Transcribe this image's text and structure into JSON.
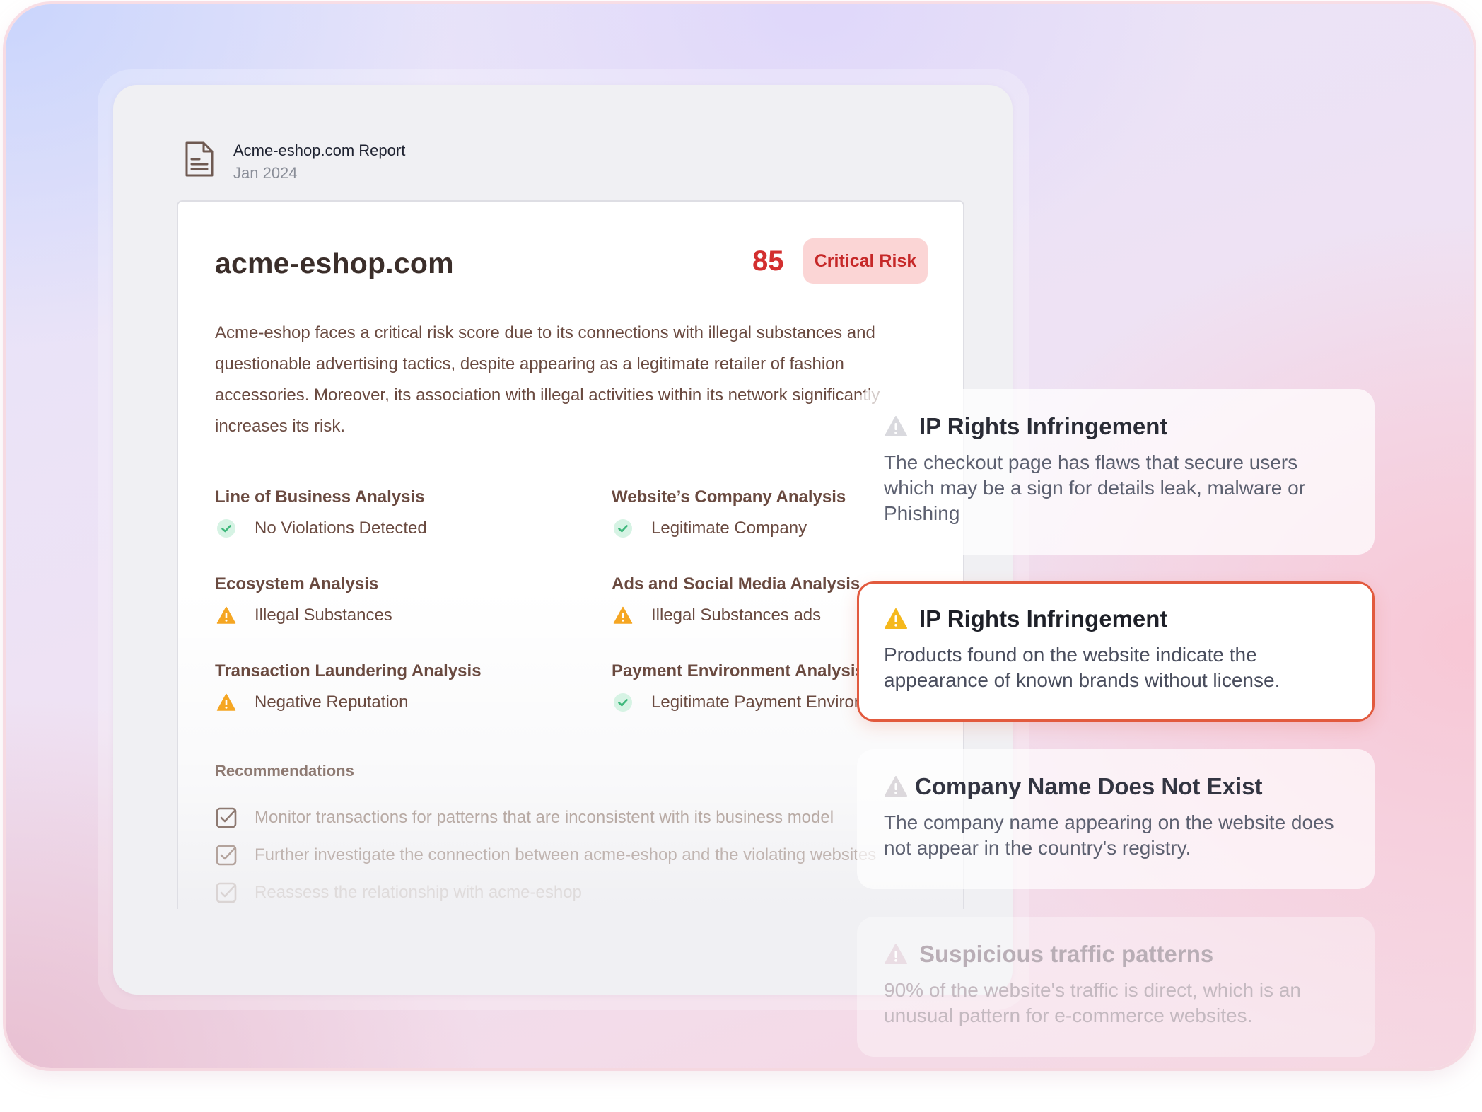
{
  "report": {
    "title": "Acme-eshop.com Report",
    "date": "Jan 2024"
  },
  "card": {
    "domain": "acme-eshop.com",
    "score": "85",
    "risk_label": "Critical Risk",
    "summary": "Acme-eshop faces a critical risk score due to its connections with illegal substances and questionable advertising tactics, despite appearing as a legitimate retailer of fashion accessories. Moreover, its association with illegal activities within its network significantly increases its risk.",
    "analyses": [
      {
        "title": "Line of Business Analysis",
        "result": "No Violations Detected",
        "status": "ok"
      },
      {
        "title": "Website’s Company Analysis",
        "result": "Legitimate Company",
        "status": "ok"
      },
      {
        "title": "Ecosystem Analysis",
        "result": "Illegal Substances",
        "status": "warning"
      },
      {
        "title": "Ads and Social Media Analysis",
        "result": "Illegal Substances ads",
        "status": "warning"
      },
      {
        "title": "Transaction Laundering Analysis",
        "result": "Negative Reputation",
        "status": "warning"
      },
      {
        "title": "Payment Environment Analysis",
        "result": "Legitimate Payment Environment",
        "status": "ok"
      }
    ],
    "recommendations_title": "Recommendations",
    "recommendations": [
      "Monitor transactions for patterns that are inconsistent with its business model",
      "Further investigate the connection between acme-eshop and the violating websites",
      "Reassess the relationship with acme-eshop"
    ]
  },
  "alerts": [
    {
      "title": "IP Rights Infringement",
      "body": "The checkout page has flaws that secure users which may be a sign for details leak, malware or Phishing",
      "icon": "warning-icon-gray"
    },
    {
      "title": "IP Rights Infringement",
      "body": "Products found on the website indicate the appearance of known brands without license.",
      "icon": "warning-icon-amber"
    },
    {
      "title": "Company Name Does Not Exist",
      "body": "The company name appearing on the website does not appear in the country's registry.",
      "icon": "warning-icon-gray"
    },
    {
      "title": "Suspicious traffic patterns",
      "body": "90% of the website's traffic is direct, which is an unusual pattern for e-commerce websites.",
      "icon": "warning-icon-gray"
    }
  ],
  "colors": {
    "critical": "#d32f2f",
    "badge_bg": "#fbd5d5",
    "ok": "#4cc38a",
    "warning": "#f5a623",
    "active_border": "#e25a3e"
  }
}
